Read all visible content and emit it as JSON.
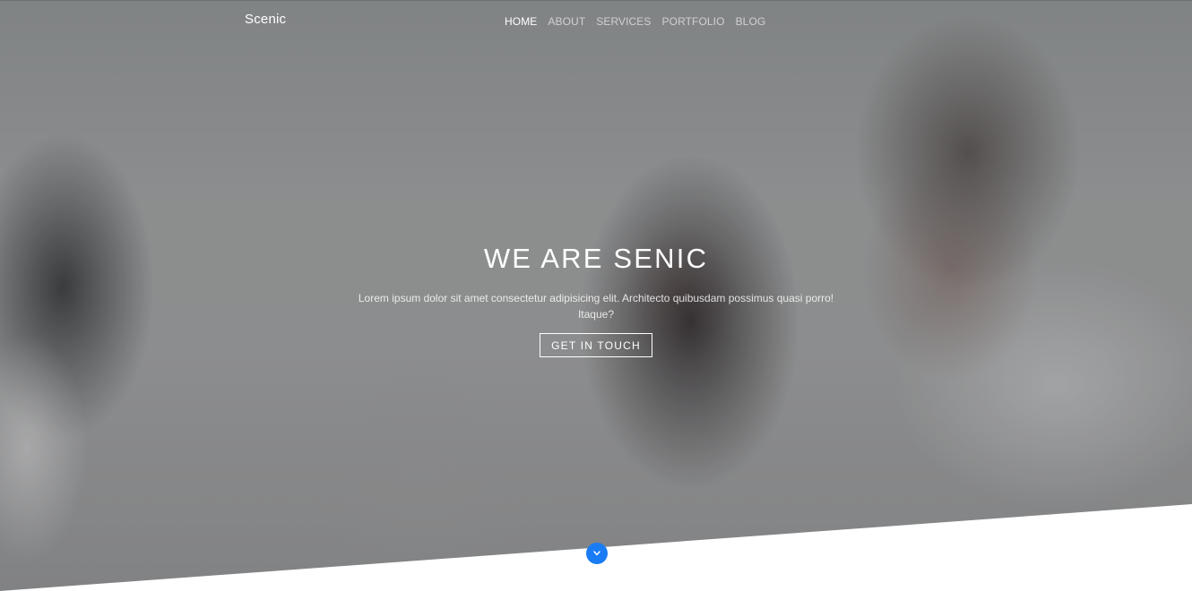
{
  "navbar": {
    "brand": "Scenic",
    "items": [
      {
        "label": "HOME",
        "active": true
      },
      {
        "label": "ABOUT",
        "active": false
      },
      {
        "label": "SERVICES",
        "active": false
      },
      {
        "label": "PORTFOLIO",
        "active": false
      },
      {
        "label": "BLOG",
        "active": false
      }
    ]
  },
  "hero": {
    "title": "WE ARE SENIC",
    "text": "Lorem ipsum dolor sit amet consectetur adipisicing elit. Architecto quibusdam possimus quasi porro! Itaque?",
    "cta_label": "GET IN TOUCH"
  },
  "scroll_down": {
    "icon": "chevron-down-icon",
    "color": "#1a7cf5"
  },
  "colors": {
    "accent": "#1a7cf5",
    "text": "#ffffff",
    "background_bottom": "#ffffff"
  }
}
